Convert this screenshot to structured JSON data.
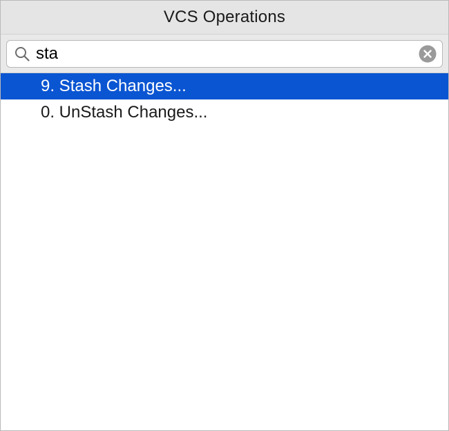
{
  "popup": {
    "title": "VCS Operations"
  },
  "search": {
    "value": "sta",
    "placeholder": ""
  },
  "icons": {
    "search": "search-icon",
    "clear": "clear-icon"
  },
  "items": [
    {
      "label": "9. Stash Changes...",
      "selected": true
    },
    {
      "label": "0. UnStash Changes...",
      "selected": false
    }
  ],
  "colors": {
    "selection": "#0a55d2",
    "title_bar": "#e5e5e5"
  }
}
